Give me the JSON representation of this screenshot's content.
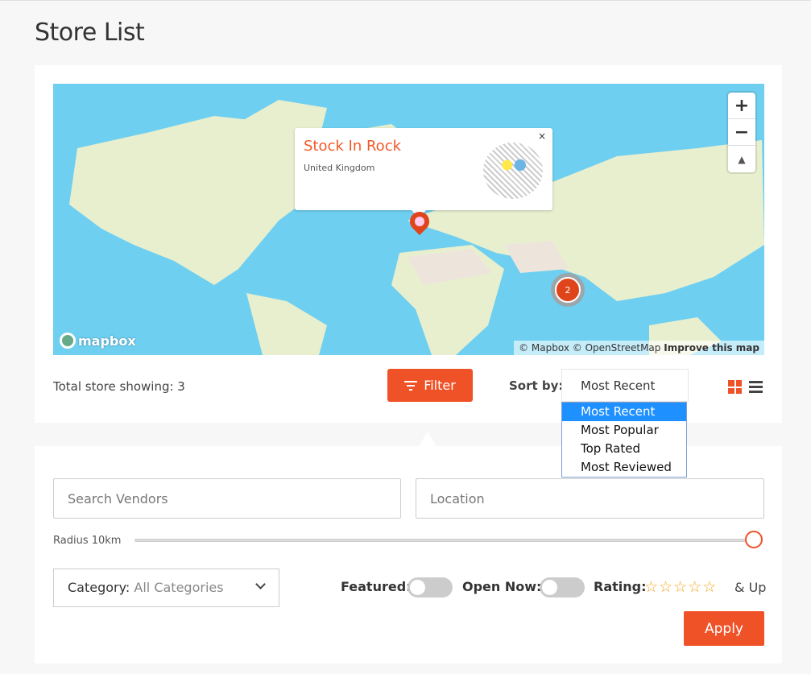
{
  "page": {
    "title": "Store List"
  },
  "map": {
    "zoom_in": "+",
    "zoom_out": "−",
    "compass": "▲",
    "logo": "mapbox",
    "attribution": "© Mapbox © OpenStreetMap",
    "improve": "Improve this map",
    "popup": {
      "title": "Stock In Rock",
      "subtitle": "United Kingdom",
      "close": "×"
    },
    "cluster_count": "2",
    "colors": {
      "water": "#6ecff0",
      "land": "#e8efcf",
      "marker": "#e0441b"
    }
  },
  "toolbar": {
    "total": "Total store showing: 3",
    "filter_label": "Filter",
    "sort_label": "Sort by:",
    "sort_value": "Most Recent",
    "sort_options": [
      "Most Recent",
      "Most Popular",
      "Top Rated",
      "Most Reviewed"
    ],
    "accent": "#f05228"
  },
  "filters": {
    "search_placeholder": "Search Vendors",
    "location_placeholder": "Location",
    "radius_label": "Radius 10km",
    "radius_value_fraction": 1.0,
    "category_label": "Category:",
    "category_value": "All Categories",
    "featured_label": "Featured:",
    "featured_on": false,
    "open_now_label": "Open Now:",
    "open_now_on": false,
    "rating_label": "Rating:",
    "rating_stars": [
      "☆",
      "☆",
      "☆",
      "☆",
      "☆"
    ],
    "rating_suffix": "& Up",
    "apply_label": "Apply"
  }
}
